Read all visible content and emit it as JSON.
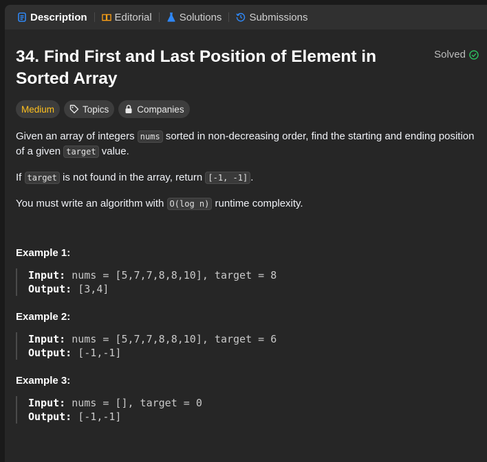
{
  "tabs": [
    {
      "label": "Description",
      "icon": "description-icon",
      "active": true
    },
    {
      "label": "Editorial",
      "icon": "book-icon",
      "active": false
    },
    {
      "label": "Solutions",
      "icon": "flask-icon",
      "active": false
    },
    {
      "label": "Submissions",
      "icon": "history-icon",
      "active": false
    }
  ],
  "problem": {
    "title": "34. Find First and Last Position of Element in Sorted Array",
    "status": "Solved",
    "difficulty": "Medium",
    "topics_label": "Topics",
    "companies_label": "Companies"
  },
  "description": {
    "p1_a": "Given an array of integers ",
    "p1_code1": "nums",
    "p1_b": " sorted in non-decreasing order, find the starting and ending position of a given ",
    "p1_code2": "target",
    "p1_c": " value.",
    "p2_a": "If ",
    "p2_code1": "target",
    "p2_b": " is not found in the array, return ",
    "p2_code2": "[-1, -1]",
    "p2_c": ".",
    "p3_a": "You must write an algorithm with ",
    "p3_code1": "O(log n)",
    "p3_b": " runtime complexity."
  },
  "examples": [
    {
      "title": "Example 1:",
      "input_label": "Input:",
      "input": " nums = [5,7,7,8,8,10], target = 8",
      "output_label": "Output:",
      "output": " [3,4]"
    },
    {
      "title": "Example 2:",
      "input_label": "Input:",
      "input": " nums = [5,7,7,8,8,10], target = 6",
      "output_label": "Output:",
      "output": " [-1,-1]"
    },
    {
      "title": "Example 3:",
      "input_label": "Input:",
      "input": " nums = [], target = 0",
      "output_label": "Output:",
      "output": " [-1,-1]"
    }
  ],
  "colors": {
    "background": "#262626",
    "tabbar": "#303030",
    "medium": "#ffc01e",
    "solved_check": "#2cbb5d",
    "description_icon": "#2f87f5",
    "solutions_icon": "#2f87f5",
    "submissions_icon": "#2f87f5"
  }
}
